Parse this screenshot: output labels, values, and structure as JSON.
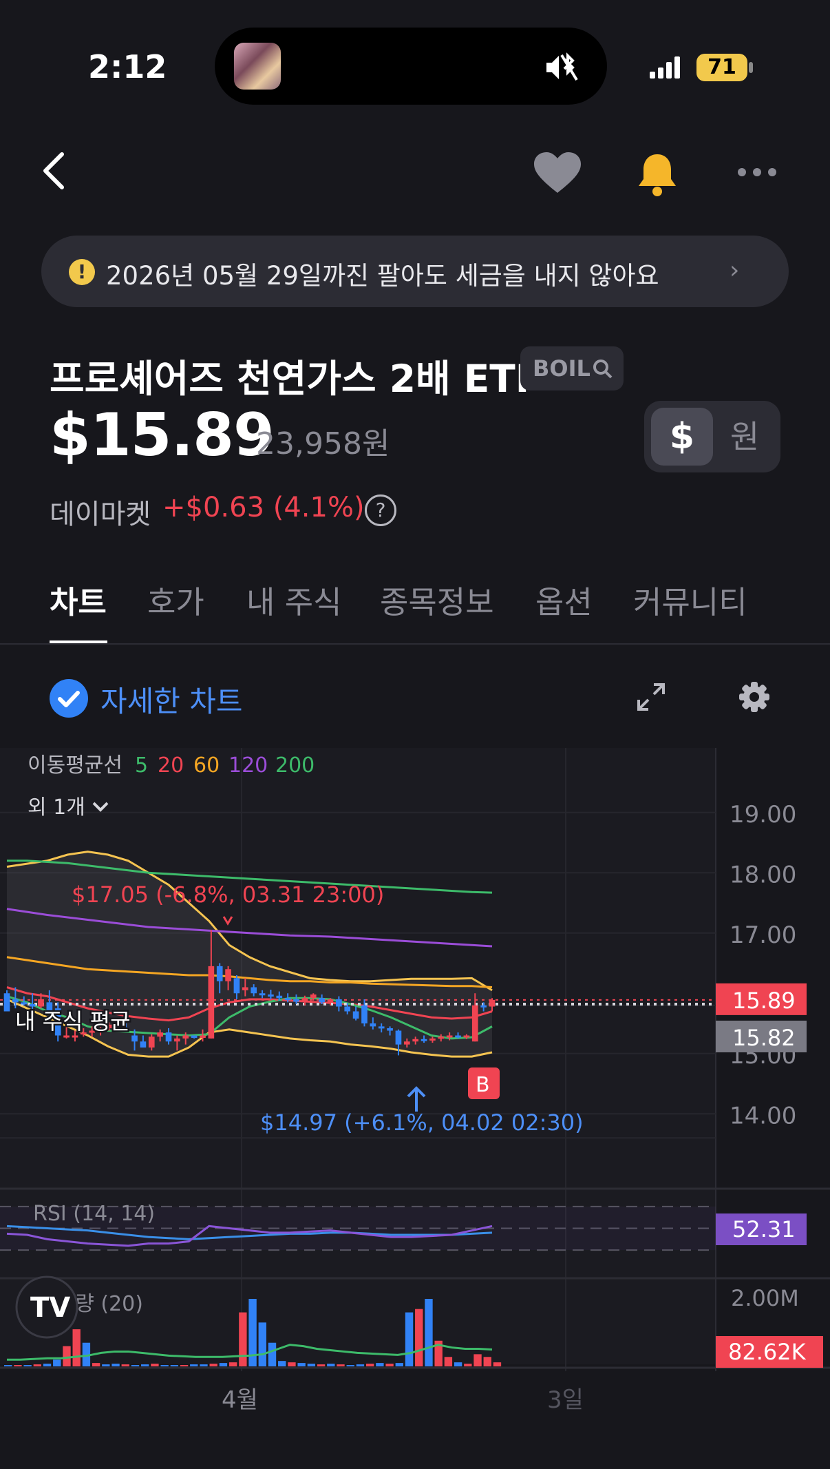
{
  "status_bar": {
    "time": "2:12",
    "battery": "71"
  },
  "notice": {
    "text": "2026년 05월 29일까진 팔아도 세금을 내지 않아요"
  },
  "stock": {
    "name": "프로셰어즈 천연가스 2배 ETF",
    "ticker": "BOIL",
    "price": "$15.89",
    "price_krw": "23,958원",
    "market_label": "데이마켓",
    "change": "+$0.63 (4.1%)"
  },
  "currency_toggle": {
    "usd": "$",
    "krw": "원",
    "selected": "usd"
  },
  "tabs": [
    {
      "label": "차트",
      "active": true
    },
    {
      "label": "호가",
      "active": false
    },
    {
      "label": "내 주식",
      "active": false
    },
    {
      "label": "종목정보",
      "active": false
    },
    {
      "label": "옵션",
      "active": false
    },
    {
      "label": "커뮤니티",
      "active": false
    }
  ],
  "chart_toolbar": {
    "detail_chart_label": "자세한 차트",
    "detail_chart_checked": true
  },
  "chart_data": {
    "type": "candlestick",
    "ma_legend": {
      "label": "이동평균선",
      "periods": [
        "5",
        "20",
        "60",
        "120",
        "200"
      ],
      "colors": [
        "#3dbb6a",
        "#f04452",
        "#f5a623",
        "#9b4dd8",
        "#3dbb6a"
      ]
    },
    "more_indicators_label": "외 1개",
    "ylim": [
      13.5,
      19.5
    ],
    "y_ticks": [
      "19.00",
      "18.00",
      "17.00",
      "15.00",
      "14.00"
    ],
    "x_labels": [
      "4월",
      "3일"
    ],
    "current_price_label": "15.89",
    "avg_price_label": "15.82",
    "avg_price_text": "내 주식 평균",
    "high_annotation": "$17.05 (-6.8%, 03.31 23:00)",
    "low_annotation": "$14.97 (+6.1%, 04.02 02:30)",
    "buy_marker": "B",
    "candles": [
      {
        "o": 16.0,
        "h": 16.05,
        "l": 15.7,
        "c": 15.7
      },
      {
        "o": 15.9,
        "h": 16.1,
        "l": 15.75,
        "c": 15.85
      },
      {
        "o": 15.85,
        "h": 15.95,
        "l": 15.8,
        "c": 15.82
      },
      {
        "o": 15.82,
        "h": 16.0,
        "l": 15.7,
        "c": 15.78
      },
      {
        "o": 15.78,
        "h": 16.0,
        "l": 15.75,
        "c": 15.9
      },
      {
        "o": 15.85,
        "h": 16.05,
        "l": 15.6,
        "c": 15.7
      },
      {
        "o": 15.75,
        "h": 15.85,
        "l": 15.2,
        "c": 15.3
      },
      {
        "o": 15.3,
        "h": 15.5,
        "l": 15.25,
        "c": 15.3
      },
      {
        "o": 15.3,
        "h": 15.38,
        "l": 15.2,
        "c": 15.3
      },
      {
        "o": 15.32,
        "h": 15.42,
        "l": 15.28,
        "c": 15.35
      },
      {
        "o": 15.35,
        "h": 15.45,
        "l": 15.28,
        "c": 15.38
      },
      {
        "o": 15.38,
        "h": 15.46,
        "l": 15.3,
        "c": 15.4
      },
      {
        "o": 15.42,
        "h": 15.52,
        "l": 15.38,
        "c": 15.48
      },
      {
        "o": 15.48,
        "h": 15.55,
        "l": 15.4,
        "c": 15.44
      },
      {
        "o": 15.44,
        "h": 15.5,
        "l": 15.36,
        "c": 15.4
      },
      {
        "o": 15.3,
        "h": 15.4,
        "l": 15.05,
        "c": 15.2
      },
      {
        "o": 15.2,
        "h": 15.3,
        "l": 15.1,
        "c": 15.1
      },
      {
        "o": 15.1,
        "h": 15.32,
        "l": 15.05,
        "c": 15.28
      },
      {
        "o": 15.28,
        "h": 15.4,
        "l": 15.2,
        "c": 15.35
      },
      {
        "o": 15.35,
        "h": 15.42,
        "l": 15.15,
        "c": 15.2
      },
      {
        "o": 15.2,
        "h": 15.3,
        "l": 15.05,
        "c": 15.25
      },
      {
        "o": 15.25,
        "h": 15.35,
        "l": 15.15,
        "c": 15.3
      },
      {
        "o": 15.3,
        "h": 15.3,
        "l": 15.25,
        "c": 15.26
      },
      {
        "o": 15.26,
        "h": 15.4,
        "l": 15.2,
        "c": 15.3
      },
      {
        "o": 15.25,
        "h": 17.05,
        "l": 15.25,
        "c": 16.45
      },
      {
        "o": 16.45,
        "h": 16.5,
        "l": 16.0,
        "c": 16.2
      },
      {
        "o": 16.2,
        "h": 16.45,
        "l": 16.05,
        "c": 16.4
      },
      {
        "o": 16.25,
        "h": 16.3,
        "l": 15.9,
        "c": 16.0
      },
      {
        "o": 16.05,
        "h": 16.25,
        "l": 15.95,
        "c": 16.1
      },
      {
        "o": 16.1,
        "h": 16.15,
        "l": 15.95,
        "c": 16.0
      },
      {
        "o": 16.0,
        "h": 16.05,
        "l": 15.92,
        "c": 15.98
      },
      {
        "o": 15.98,
        "h": 16.06,
        "l": 15.9,
        "c": 15.96
      },
      {
        "o": 15.96,
        "h": 16.03,
        "l": 15.88,
        "c": 15.92
      },
      {
        "o": 15.92,
        "h": 16.0,
        "l": 15.85,
        "c": 15.9
      },
      {
        "o": 15.9,
        "h": 15.98,
        "l": 15.82,
        "c": 15.86
      },
      {
        "o": 15.86,
        "h": 15.96,
        "l": 15.8,
        "c": 15.92
      },
      {
        "o": 15.92,
        "h": 16.0,
        "l": 15.88,
        "c": 15.98
      },
      {
        "o": 15.92,
        "h": 15.98,
        "l": 15.82,
        "c": 15.85
      },
      {
        "o": 15.85,
        "h": 15.92,
        "l": 15.8,
        "c": 15.9
      },
      {
        "o": 15.9,
        "h": 15.95,
        "l": 15.7,
        "c": 15.78
      },
      {
        "o": 15.78,
        "h": 15.84,
        "l": 15.65,
        "c": 15.7
      },
      {
        "o": 15.7,
        "h": 15.78,
        "l": 15.55,
        "c": 15.58
      },
      {
        "o": 15.8,
        "h": 15.9,
        "l": 15.45,
        "c": 15.5
      },
      {
        "o": 15.5,
        "h": 15.6,
        "l": 15.4,
        "c": 15.45
      },
      {
        "o": 15.45,
        "h": 15.5,
        "l": 15.35,
        "c": 15.42
      },
      {
        "o": 15.42,
        "h": 15.45,
        "l": 15.3,
        "c": 15.38
      },
      {
        "o": 15.38,
        "h": 15.4,
        "l": 14.97,
        "c": 15.15
      },
      {
        "o": 15.15,
        "h": 15.25,
        "l": 15.1,
        "c": 15.2
      },
      {
        "o": 15.2,
        "h": 15.28,
        "l": 15.15,
        "c": 15.24
      },
      {
        "o": 15.24,
        "h": 15.3,
        "l": 15.18,
        "c": 15.22
      },
      {
        "o": 15.22,
        "h": 15.28,
        "l": 15.18,
        "c": 15.25
      },
      {
        "o": 15.25,
        "h": 15.32,
        "l": 15.2,
        "c": 15.28
      },
      {
        "o": 15.28,
        "h": 15.35,
        "l": 15.22,
        "c": 15.3
      },
      {
        "o": 15.3,
        "h": 15.35,
        "l": 15.25,
        "c": 15.28
      },
      {
        "o": 15.28,
        "h": 15.32,
        "l": 15.24,
        "c": 15.3
      },
      {
        "o": 15.2,
        "h": 16.0,
        "l": 15.2,
        "c": 15.8
      },
      {
        "o": 15.8,
        "h": 15.85,
        "l": 15.7,
        "c": 15.78
      },
      {
        "o": 15.78,
        "h": 15.92,
        "l": 15.7,
        "c": 15.89
      }
    ],
    "ma5": [
      15.95,
      15.85,
      15.7,
      15.6,
      15.45,
      15.38,
      15.36,
      15.34,
      15.32,
      15.3,
      15.32,
      15.6,
      15.78,
      15.86,
      15.92,
      15.92,
      15.9,
      15.82,
      15.72,
      15.6,
      15.45,
      15.3,
      15.25,
      15.27,
      15.45
    ],
    "ma20": [
      16.1,
      16.0,
      15.95,
      15.85,
      15.75,
      15.68,
      15.62,
      15.58,
      15.55,
      15.6,
      15.75,
      15.85,
      15.9,
      15.9,
      15.88,
      15.86,
      15.84,
      15.82,
      15.78,
      15.72,
      15.66,
      15.6,
      15.58,
      15.6,
      15.7
    ],
    "ma60": [
      16.6,
      16.55,
      16.5,
      16.45,
      16.4,
      16.38,
      16.36,
      16.34,
      16.32,
      16.3,
      16.3,
      16.28,
      16.25,
      16.22,
      16.2,
      16.2,
      16.18,
      16.18,
      16.16,
      16.15,
      16.14,
      16.13,
      16.12,
      16.12,
      16.1
    ],
    "ma120": [
      17.4,
      17.35,
      17.3,
      17.26,
      17.22,
      17.18,
      17.14,
      17.1,
      17.08,
      17.06,
      17.04,
      17.02,
      17.0,
      16.98,
      16.96,
      16.95,
      16.94,
      16.92,
      16.9,
      16.88,
      16.86,
      16.84,
      16.82,
      16.8,
      16.78
    ],
    "ma200": [
      18.2,
      18.2,
      18.18,
      18.16,
      18.12,
      18.08,
      18.04,
      18.0,
      17.98,
      17.96,
      17.94,
      17.92,
      17.9,
      17.88,
      17.86,
      17.84,
      17.82,
      17.8,
      17.78,
      17.76,
      17.74,
      17.72,
      17.7,
      17.68,
      17.67
    ],
    "bb_upper": [
      18.1,
      18.15,
      18.2,
      18.3,
      18.35,
      18.3,
      18.2,
      18.0,
      17.8,
      17.5,
      17.2,
      16.8,
      16.6,
      16.45,
      16.35,
      16.25,
      16.22,
      16.2,
      16.2,
      16.22,
      16.24,
      16.24,
      16.24,
      16.25,
      16.05
    ],
    "bb_lower": [
      15.9,
      15.75,
      15.6,
      15.45,
      15.3,
      15.12,
      14.98,
      14.95,
      14.95,
      15.1,
      15.35,
      15.4,
      15.35,
      15.3,
      15.25,
      15.22,
      15.2,
      15.15,
      15.12,
      15.08,
      15.02,
      14.98,
      14.95,
      14.95,
      15.02
    ],
    "rsi": {
      "label": "RSI (14, 14)",
      "value": "52.31",
      "levels": [
        70,
        50,
        30
      ],
      "line1": [
        45,
        44,
        40,
        38,
        36,
        35,
        34,
        36,
        36,
        38,
        52,
        50,
        48,
        46,
        46,
        47,
        48,
        46,
        44,
        42,
        42,
        43,
        44,
        48,
        52
      ],
      "line2": [
        52,
        51,
        50,
        49,
        48,
        46,
        44,
        42,
        41,
        40,
        41,
        42,
        43,
        44,
        45,
        45,
        46,
        46,
        45,
        44,
        44,
        44,
        44,
        45,
        46
      ]
    },
    "volume": {
      "label": "거래량 (20)",
      "top_tick": "2.00M",
      "value": "82.62K",
      "bars": [
        0.02,
        0.02,
        0.02,
        0.03,
        0.04,
        0.1,
        0.3,
        0.55,
        0.35,
        0.05,
        0.03,
        0.04,
        0.03,
        0.02,
        0.03,
        0.04,
        0.02,
        0.02,
        0.02,
        0.03,
        0.03,
        0.04,
        0.05,
        0.06,
        0.8,
        1.0,
        0.65,
        0.35,
        0.08,
        0.06,
        0.05,
        0.04,
        0.03,
        0.04,
        0.03,
        0.02,
        0.03,
        0.04,
        0.05,
        0.04,
        0.05,
        0.8,
        0.85,
        1.0,
        0.38,
        0.14,
        0.06,
        0.04,
        0.18,
        0.14,
        0.06
      ],
      "bar_up": [
        false,
        true,
        false,
        true,
        false,
        false,
        true,
        true,
        false,
        true,
        false,
        false,
        true,
        false,
        false,
        true,
        false,
        false,
        true,
        false,
        false,
        true,
        false,
        true,
        true,
        false,
        false,
        false,
        false,
        true,
        false,
        false,
        true,
        false,
        true,
        false,
        false,
        true,
        false,
        true,
        false,
        false,
        true,
        false,
        true,
        true,
        false,
        true,
        true,
        true,
        true
      ],
      "ma": [
        0.1,
        0.1,
        0.11,
        0.12,
        0.12,
        0.14,
        0.16,
        0.2,
        0.22,
        0.22,
        0.2,
        0.18,
        0.16,
        0.15,
        0.14,
        0.14,
        0.14,
        0.15,
        0.16,
        0.18,
        0.25,
        0.32,
        0.3,
        0.26,
        0.24,
        0.22,
        0.2,
        0.19,
        0.18,
        0.17,
        0.2,
        0.26,
        0.32,
        0.28,
        0.26,
        0.26,
        0.25
      ]
    }
  },
  "colors": {
    "up": "#f04452",
    "down": "#3182f6",
    "bg": "#17171c",
    "panel": "#2c2c34",
    "accent": "#3182f6"
  },
  "icons": [
    "back-icon",
    "heart-icon",
    "bell-icon",
    "more-icon",
    "warning-icon",
    "chevron-right-icon",
    "search-icon",
    "help-icon",
    "check-icon",
    "expand-icon",
    "gear-icon"
  ]
}
